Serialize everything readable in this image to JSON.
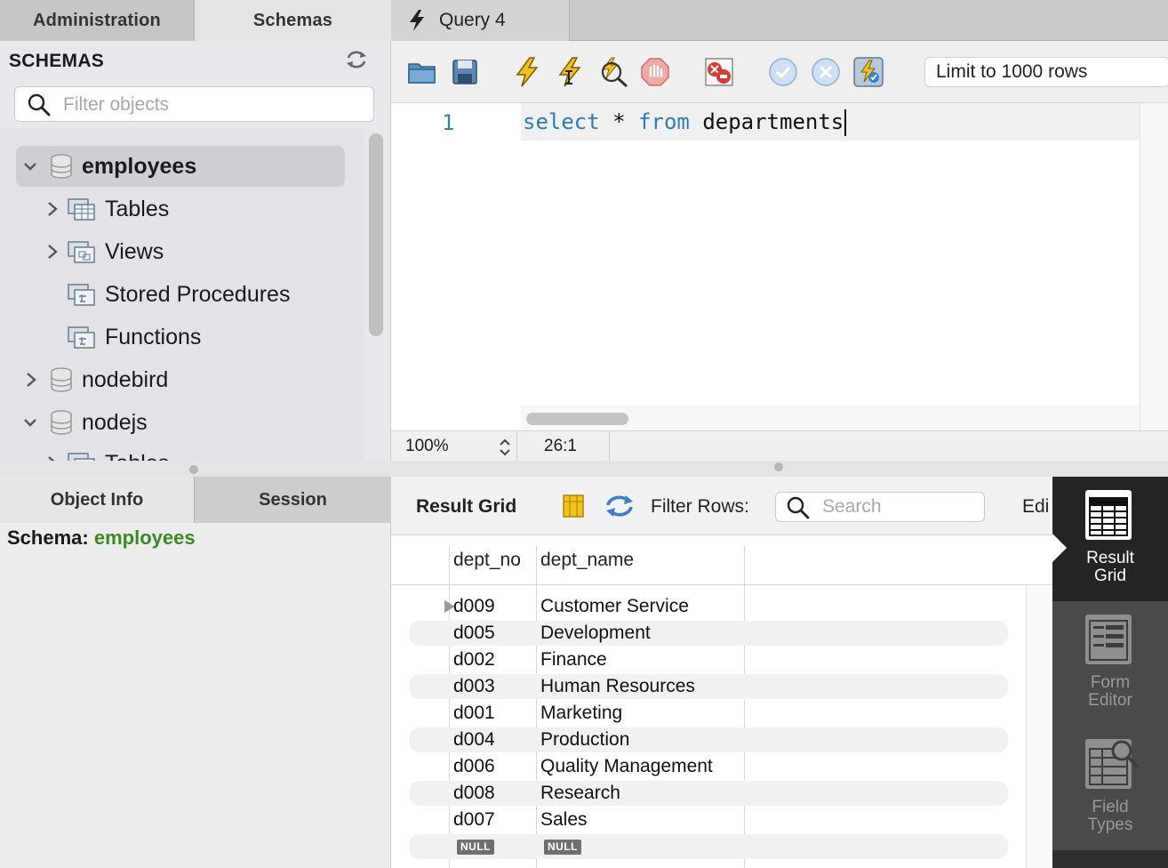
{
  "left_tabs": {
    "administration": "Administration",
    "schemas": "Schemas"
  },
  "schemas": {
    "title": "SCHEMAS",
    "filter_placeholder": "Filter objects",
    "tree": [
      {
        "name": "employees",
        "expanded": true,
        "selected": true
      },
      {
        "name": "Tables",
        "child": true,
        "has_arrow": true
      },
      {
        "name": "Views",
        "child": true,
        "has_arrow": true
      },
      {
        "name": "Stored Procedures",
        "child": true,
        "has_arrow": false
      },
      {
        "name": "Functions",
        "child": true,
        "has_arrow": false
      },
      {
        "name": "nodebird",
        "expanded": false
      },
      {
        "name": "nodejs",
        "expanded": true
      },
      {
        "name": "Tables",
        "child": true,
        "has_arrow": true
      }
    ]
  },
  "query_tab": {
    "label": "Query 4"
  },
  "toolbar": {
    "limit_select": "Limit to 1000 rows"
  },
  "editor": {
    "line_number": "1",
    "code": {
      "kw1": "select",
      "op": "*",
      "kw2": "from",
      "ident": "departments"
    }
  },
  "status": {
    "zoom": "100%",
    "cursor": "26:1"
  },
  "bottom_tabs": {
    "object_info": "Object Info",
    "session": "Session"
  },
  "object_info": {
    "label": "Schema:",
    "value": "employees"
  },
  "result_toolbar": {
    "title": "Result Grid",
    "filter_label": "Filter Rows:",
    "search_placeholder": "Search",
    "edit_label": "Edi"
  },
  "grid": {
    "columns": [
      "dept_no",
      "dept_name"
    ],
    "rows": [
      [
        "d009",
        "Customer Service"
      ],
      [
        "d005",
        "Development"
      ],
      [
        "d002",
        "Finance"
      ],
      [
        "d003",
        "Human Resources"
      ],
      [
        "d001",
        "Marketing"
      ],
      [
        "d004",
        "Production"
      ],
      [
        "d006",
        "Quality Management"
      ],
      [
        "d008",
        "Research"
      ],
      [
        "d007",
        "Sales"
      ]
    ],
    "null_label": "NULL"
  },
  "sidebar": {
    "result_grid": "Result\nGrid",
    "form_editor": "Form\nEditor",
    "field_types": "Field\nTypes"
  },
  "colors": {
    "accent_keyword": "#2d7cb3",
    "schema_value": "#3a8a24",
    "sidebar_bg": "#2f2f2f"
  }
}
